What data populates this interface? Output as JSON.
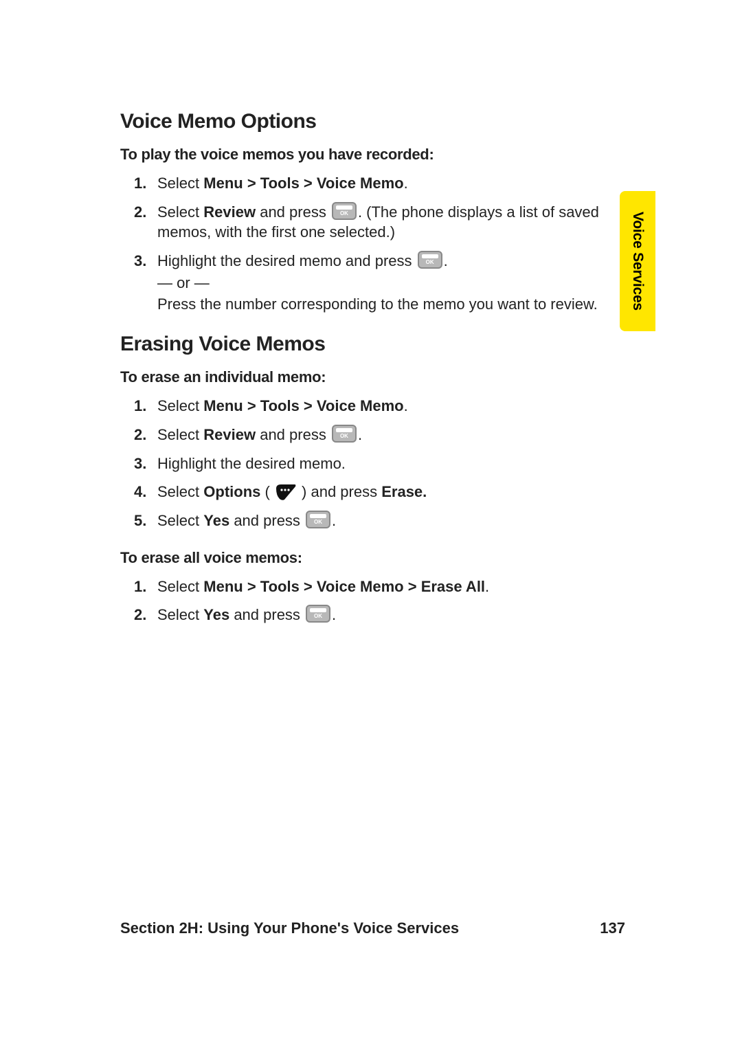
{
  "side_tab": "Voice Services",
  "h1": "Voice Memo Options",
  "lead1": "To play the voice memos you have recorded:",
  "play": {
    "s1_a": "Select ",
    "s1_b": "Menu > Tools > Voice Memo",
    "s1_c": ".",
    "s2_a": "Select ",
    "s2_b": "Review",
    "s2_c": " and press ",
    "s2_d": ". (The phone displays a list of saved memos, with the first one selected.)",
    "s3_a": "Highlight the desired memo and press ",
    "s3_b": ".",
    "s3_or": "— or —",
    "s3_c": "Press the number corresponding to the memo you want to review."
  },
  "h2": "Erasing Voice Memos",
  "lead2": "To erase an individual memo:",
  "erase_one": {
    "s1_a": "Select ",
    "s1_b": "Menu > Tools > Voice Memo",
    "s1_c": ".",
    "s2_a": "Select ",
    "s2_b": "Review",
    "s2_c": " and press ",
    "s2_d": ".",
    "s3": "Highlight the desired memo.",
    "s4_a": "Select ",
    "s4_b": "Options",
    "s4_c": " ( ",
    "s4_d": " ) and press ",
    "s4_e": "Erase.",
    "s5_a": "Select ",
    "s5_b": "Yes",
    "s5_c": " and press ",
    "s5_d": "."
  },
  "lead3": "To erase all voice memos:",
  "erase_all": {
    "s1_a": "Select ",
    "s1_b": "Menu > Tools > Voice Memo > Erase All",
    "s1_c": ".",
    "s2_a": "Select ",
    "s2_b": "Yes",
    "s2_c": " and press ",
    "s2_d": "."
  },
  "footer": {
    "section": "Section 2H: Using Your Phone's Voice Services",
    "page": "137"
  }
}
